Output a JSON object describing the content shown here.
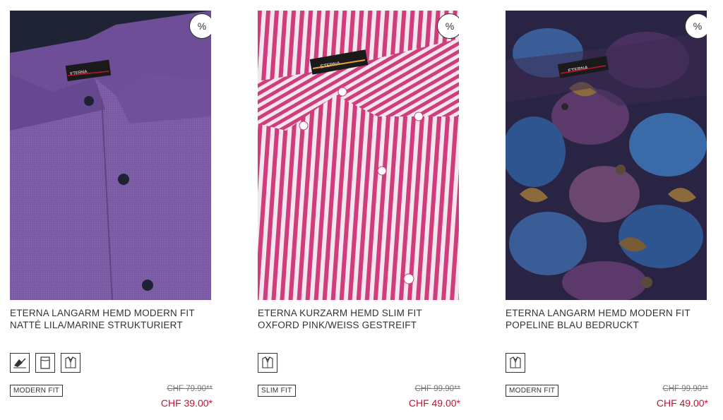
{
  "products": [
    {
      "title_line1": "ETERNA LANGARM HEMD MODERN FIT",
      "title_line2": "NATTÉ LILA/MARINE STRUKTURIERT",
      "sale_badge": "%",
      "fit": "MODERN FIT",
      "price_old": "CHF 79.90**",
      "price_new": "CHF 39.00*",
      "image_icon": "purple-shirt-image",
      "features": [
        "easy-iron-icon",
        "fabric-icon",
        "shirt-collar-icon"
      ]
    },
    {
      "title_line1": "ETERNA KURZARM HEMD SLIM FIT",
      "title_line2": "OXFORD PINK/WEISS GESTREIFT",
      "sale_badge": "%",
      "fit": "SLIM FIT",
      "price_old": "CHF 99.90**",
      "price_new": "CHF 49.00*",
      "image_icon": "pink-striped-shirt-image",
      "features": [
        "shirt-collar-icon"
      ]
    },
    {
      "title_line1": "ETERNA LANGARM HEMD MODERN FIT",
      "title_line2": "POPELINE BLAU BEDRUCKT",
      "sale_badge": "%",
      "fit": "MODERN FIT",
      "price_old": "CHF 99.90**",
      "price_new": "CHF 49.00*",
      "image_icon": "floral-print-shirt-image",
      "features": [
        "shirt-collar-icon"
      ]
    }
  ],
  "colors": {
    "sale_price": "#c4122f",
    "old_price": "#777777",
    "text": "#333333"
  }
}
